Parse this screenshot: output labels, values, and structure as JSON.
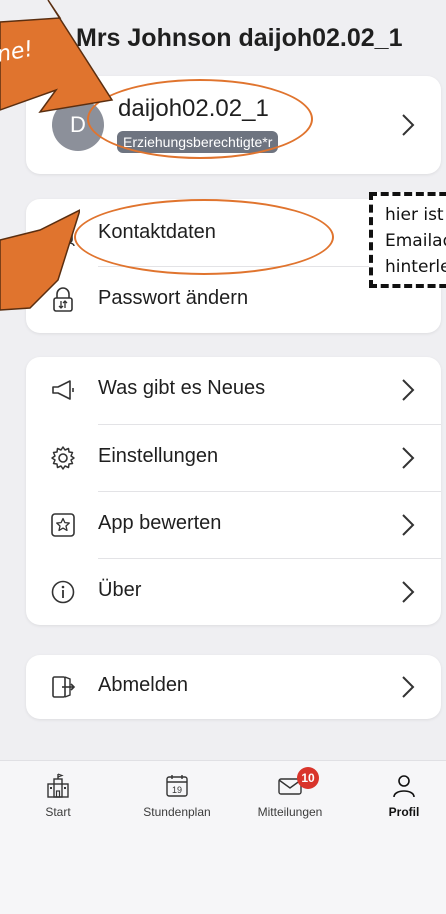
{
  "header": {
    "title": "Mrs Johnson daijoh02.02_1",
    "back_icon": "back-arrow-icon"
  },
  "profile": {
    "avatar_initial": "D",
    "name": "daijoh02.02_1",
    "role": "Erziehungsberechtigte*r"
  },
  "account_menu": [
    {
      "label": "Kontaktdaten",
      "icon": "contact-card-icon"
    },
    {
      "label": "Passwort ändern",
      "icon": "lock-icon"
    }
  ],
  "misc_menu": [
    {
      "label": "Was gibt es Neues",
      "icon": "megaphone-icon"
    },
    {
      "label": "Einstellungen",
      "icon": "gear-icon"
    },
    {
      "label": "App bewerten",
      "icon": "star-icon"
    },
    {
      "label": "Über",
      "icon": "info-icon"
    }
  ],
  "logout": {
    "label": "Abmelden",
    "icon": "logout-icon"
  },
  "annotation": {
    "callout_line1": "hier ist Ih",
    "callout_line2": "Emailad",
    "callout_line3": "hinterleg",
    "arrow_text": "ne!",
    "accent_color": "#e0742e"
  },
  "tabbar": {
    "tabs": [
      {
        "label": "Start",
        "icon": "school-icon",
        "active": false
      },
      {
        "label": "Stundenplan",
        "icon": "calendar-icon",
        "calendar_day": "19",
        "active": false
      },
      {
        "label": "Mitteilungen",
        "icon": "mail-icon",
        "badge": "10",
        "active": false
      },
      {
        "label": "Profil",
        "icon": "person-icon",
        "active": true
      }
    ]
  }
}
